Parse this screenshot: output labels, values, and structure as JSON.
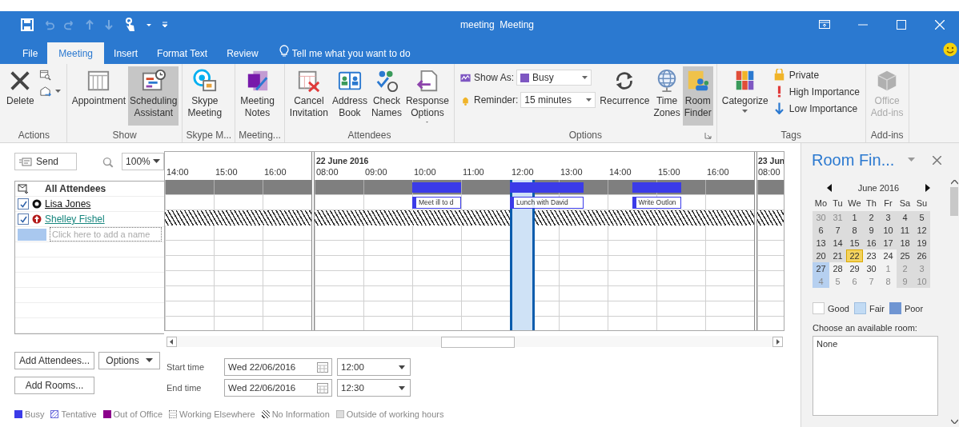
{
  "window": {
    "title": "meeting  Meeting"
  },
  "tabs": [
    {
      "label": "File",
      "selected": false
    },
    {
      "label": "Meeting",
      "selected": true
    },
    {
      "label": "Insert",
      "selected": false
    },
    {
      "label": "Format Text",
      "selected": false
    },
    {
      "label": "Review",
      "selected": false
    }
  ],
  "tell_me": {
    "placeholder": "Tell me what you want to do"
  },
  "ribbon": {
    "groups": [
      {
        "label": "Actions",
        "launcher": false,
        "items": [
          {
            "kind": "large",
            "label": "Delete",
            "selected": false,
            "disabled": false,
            "menu": false
          },
          {
            "kind": "stack",
            "rows": [
              {
                "menu": false
              },
              {
                "menu": true
              }
            ]
          }
        ]
      },
      {
        "label": "Show",
        "launcher": false,
        "items": [
          {
            "kind": "large",
            "label": "Appointment",
            "selected": false,
            "disabled": false,
            "menu": false
          },
          {
            "kind": "large",
            "label": "Scheduling\nAssistant",
            "selected": true,
            "disabled": false,
            "menu": false
          }
        ]
      },
      {
        "label": "Skype M...",
        "launcher": false,
        "items": [
          {
            "kind": "large",
            "label": "Skype\nMeeting",
            "selected": false,
            "disabled": false,
            "menu": false
          }
        ]
      },
      {
        "label": "Meeting...",
        "launcher": false,
        "items": [
          {
            "kind": "large",
            "label": "Meeting\nNotes",
            "selected": false,
            "disabled": false,
            "menu": false
          }
        ]
      },
      {
        "label": "Attendees",
        "launcher": false,
        "items": [
          {
            "kind": "large",
            "label": "Cancel\nInvitation",
            "selected": false,
            "disabled": false,
            "menu": false
          },
          {
            "kind": "large",
            "label": "Address\nBook",
            "selected": false,
            "disabled": false,
            "menu": false
          },
          {
            "kind": "large",
            "label": "Check\nNames",
            "selected": false,
            "disabled": false,
            "menu": false
          },
          {
            "kind": "large",
            "label": "Response\nOptions",
            "selected": false,
            "disabled": false,
            "menu": true
          }
        ]
      },
      {
        "label": "Options",
        "launcher": true,
        "items": [
          {
            "kind": "fields",
            "rows": [
              {
                "label": "Show As:",
                "value": "Busy",
                "swatch": true
              },
              {
                "label": "Reminder:",
                "value": "15 minutes",
                "swatch": false
              }
            ]
          },
          {
            "kind": "large",
            "label": "Recurrence",
            "selected": false,
            "disabled": false,
            "menu": false
          },
          {
            "kind": "large",
            "label": "Time\nZones",
            "selected": false,
            "disabled": false,
            "menu": false
          },
          {
            "kind": "large",
            "label": "Room\nFinder",
            "selected": true,
            "disabled": false,
            "menu": false
          }
        ]
      },
      {
        "label": "Tags",
        "launcher": false,
        "items": [
          {
            "kind": "large",
            "label": "Categorize",
            "selected": false,
            "disabled": false,
            "menu": true
          },
          {
            "kind": "stack",
            "rows": [
              {
                "label": "Private",
                "menu": false
              },
              {
                "label": "High Importance",
                "menu": false
              },
              {
                "label": "Low Importance",
                "menu": false
              }
            ]
          }
        ]
      },
      {
        "label": "Add-ins",
        "launcher": false,
        "items": [
          {
            "kind": "large",
            "label": "Office\nAdd-ins",
            "selected": false,
            "disabled": true,
            "menu": false
          }
        ]
      }
    ]
  },
  "scheduling": {
    "send": "Send",
    "zoom": "100%",
    "all_attendees": "All Attendees",
    "days": [
      {
        "hours": [
          "14:00",
          "15:00",
          "16:00"
        ]
      },
      {
        "date": "22 June 2016",
        "hours": [
          "08:00",
          "09:00",
          "10:00",
          "11:00",
          "12:00",
          "13:00",
          "14:00",
          "15:00",
          "16:00"
        ]
      },
      {
        "date": "23 Jun",
        "hours": [
          "08:00"
        ]
      }
    ],
    "attendees": [
      {
        "name": "Lisa Jones",
        "checked": true,
        "kind": "organizer",
        "no_information": false,
        "events": [
          {
            "label": "Meet ill to d"
          },
          {
            "label": "Lunch with David"
          },
          {
            "label": "Write Outlon"
          }
        ]
      },
      {
        "name": "Shelley Fishel",
        "checked": true,
        "kind": "required",
        "no_information": true
      }
    ],
    "add_name": {
      "placeholder": "Click here to add a name"
    },
    "add_attendees": "Add Attendees...",
    "options": "Options",
    "add_rooms": "Add Rooms...",
    "times": [
      {
        "label": "Start time",
        "date": "Wed 22/06/2016",
        "time": "12:00"
      },
      {
        "label": "End time",
        "date": "Wed 22/06/2016",
        "time": "12:30"
      }
    ],
    "legend": [
      {
        "label": "Busy",
        "kind": "busy"
      },
      {
        "label": "Tentative",
        "kind": "tentative"
      },
      {
        "label": "Out of Office",
        "kind": "oof"
      },
      {
        "label": "Working Elsewhere",
        "kind": "elsewhere"
      },
      {
        "label": "No Information",
        "kind": "noinfo"
      },
      {
        "label": "Outside of working hours",
        "kind": "outside"
      }
    ]
  },
  "room_finder": {
    "title": "Room Fin...",
    "month": "June 2016",
    "weekdays": [
      "Mo",
      "Tu",
      "We",
      "Th",
      "Fr",
      "Sa",
      "Su"
    ],
    "weeks": [
      [
        {
          "label": "30",
          "muted": true,
          "shaded": true,
          "selected": false,
          "highlighted": false
        },
        {
          "label": "31",
          "muted": true,
          "shaded": true,
          "selected": false,
          "highlighted": false
        },
        {
          "label": "1",
          "muted": false,
          "shaded": true,
          "selected": false,
          "highlighted": false
        },
        {
          "label": "2",
          "muted": false,
          "shaded": true,
          "selected": false,
          "highlighted": false
        },
        {
          "label": "3",
          "muted": false,
          "shaded": true,
          "selected": false,
          "highlighted": false
        },
        {
          "label": "4",
          "muted": false,
          "shaded": true,
          "selected": false,
          "highlighted": false
        },
        {
          "label": "5",
          "muted": false,
          "shaded": true,
          "selected": false,
          "highlighted": false
        }
      ],
      [
        {
          "label": "6",
          "muted": false,
          "shaded": true,
          "selected": false,
          "highlighted": false
        },
        {
          "label": "7",
          "muted": false,
          "shaded": true,
          "selected": false,
          "highlighted": false
        },
        {
          "label": "8",
          "muted": false,
          "shaded": true,
          "selected": false,
          "highlighted": false
        },
        {
          "label": "9",
          "muted": false,
          "shaded": true,
          "selected": false,
          "highlighted": false
        },
        {
          "label": "10",
          "muted": false,
          "shaded": true,
          "selected": false,
          "highlighted": false
        },
        {
          "label": "11",
          "muted": false,
          "shaded": true,
          "selected": false,
          "highlighted": false
        },
        {
          "label": "12",
          "muted": false,
          "shaded": true,
          "selected": false,
          "highlighted": false
        }
      ],
      [
        {
          "label": "13",
          "muted": false,
          "shaded": true,
          "selected": false,
          "highlighted": false
        },
        {
          "label": "14",
          "muted": false,
          "shaded": true,
          "selected": false,
          "highlighted": false
        },
        {
          "label": "15",
          "muted": false,
          "shaded": true,
          "selected": false,
          "highlighted": false
        },
        {
          "label": "16",
          "muted": false,
          "shaded": true,
          "selected": false,
          "highlighted": false
        },
        {
          "label": "17",
          "muted": false,
          "shaded": true,
          "selected": false,
          "highlighted": false
        },
        {
          "label": "18",
          "muted": false,
          "shaded": true,
          "selected": false,
          "highlighted": false
        },
        {
          "label": "19",
          "muted": false,
          "shaded": true,
          "selected": false,
          "highlighted": false
        }
      ],
      [
        {
          "label": "20",
          "muted": false,
          "shaded": true,
          "selected": false,
          "highlighted": false
        },
        {
          "label": "21",
          "muted": false,
          "shaded": true,
          "selected": false,
          "highlighted": false
        },
        {
          "label": "22",
          "muted": false,
          "shaded": false,
          "selected": true,
          "highlighted": false
        },
        {
          "label": "23",
          "muted": false,
          "shaded": false,
          "selected": false,
          "highlighted": false
        },
        {
          "label": "24",
          "muted": false,
          "shaded": false,
          "selected": false,
          "highlighted": false
        },
        {
          "label": "25",
          "muted": false,
          "shaded": true,
          "selected": false,
          "highlighted": false
        },
        {
          "label": "26",
          "muted": false,
          "shaded": true,
          "selected": false,
          "highlighted": false
        }
      ],
      [
        {
          "label": "27",
          "muted": false,
          "shaded": false,
          "selected": false,
          "highlighted": true
        },
        {
          "label": "28",
          "muted": false,
          "shaded": false,
          "selected": false,
          "highlighted": false
        },
        {
          "label": "29",
          "muted": false,
          "shaded": false,
          "selected": false,
          "highlighted": false
        },
        {
          "label": "30",
          "muted": false,
          "shaded": false,
          "selected": false,
          "highlighted": false
        },
        {
          "label": "1",
          "muted": true,
          "shaded": false,
          "selected": false,
          "highlighted": false
        },
        {
          "label": "2",
          "muted": true,
          "shaded": true,
          "selected": false,
          "highlighted": false
        },
        {
          "label": "3",
          "muted": true,
          "shaded": true,
          "selected": false,
          "highlighted": false
        }
      ],
      [
        {
          "label": "4",
          "muted": true,
          "shaded": false,
          "selected": false,
          "highlighted": true
        },
        {
          "label": "5",
          "muted": true,
          "shaded": false,
          "selected": false,
          "highlighted": false
        },
        {
          "label": "6",
          "muted": true,
          "shaded": false,
          "selected": false,
          "highlighted": false
        },
        {
          "label": "7",
          "muted": true,
          "shaded": false,
          "selected": false,
          "highlighted": false
        },
        {
          "label": "8",
          "muted": true,
          "shaded": false,
          "selected": false,
          "highlighted": false
        },
        {
          "label": "9",
          "muted": true,
          "shaded": true,
          "selected": false,
          "highlighted": false
        },
        {
          "label": "10",
          "muted": true,
          "shaded": true,
          "selected": false,
          "highlighted": false
        }
      ]
    ],
    "availability": [
      {
        "label": "Good",
        "kind": "good"
      },
      {
        "label": "Fair",
        "kind": "fair"
      },
      {
        "label": "Poor",
        "kind": "poor"
      }
    ],
    "choose_label": "Choose an available room:",
    "rooms": [
      {
        "label": "None",
        "selected": false
      }
    ]
  }
}
